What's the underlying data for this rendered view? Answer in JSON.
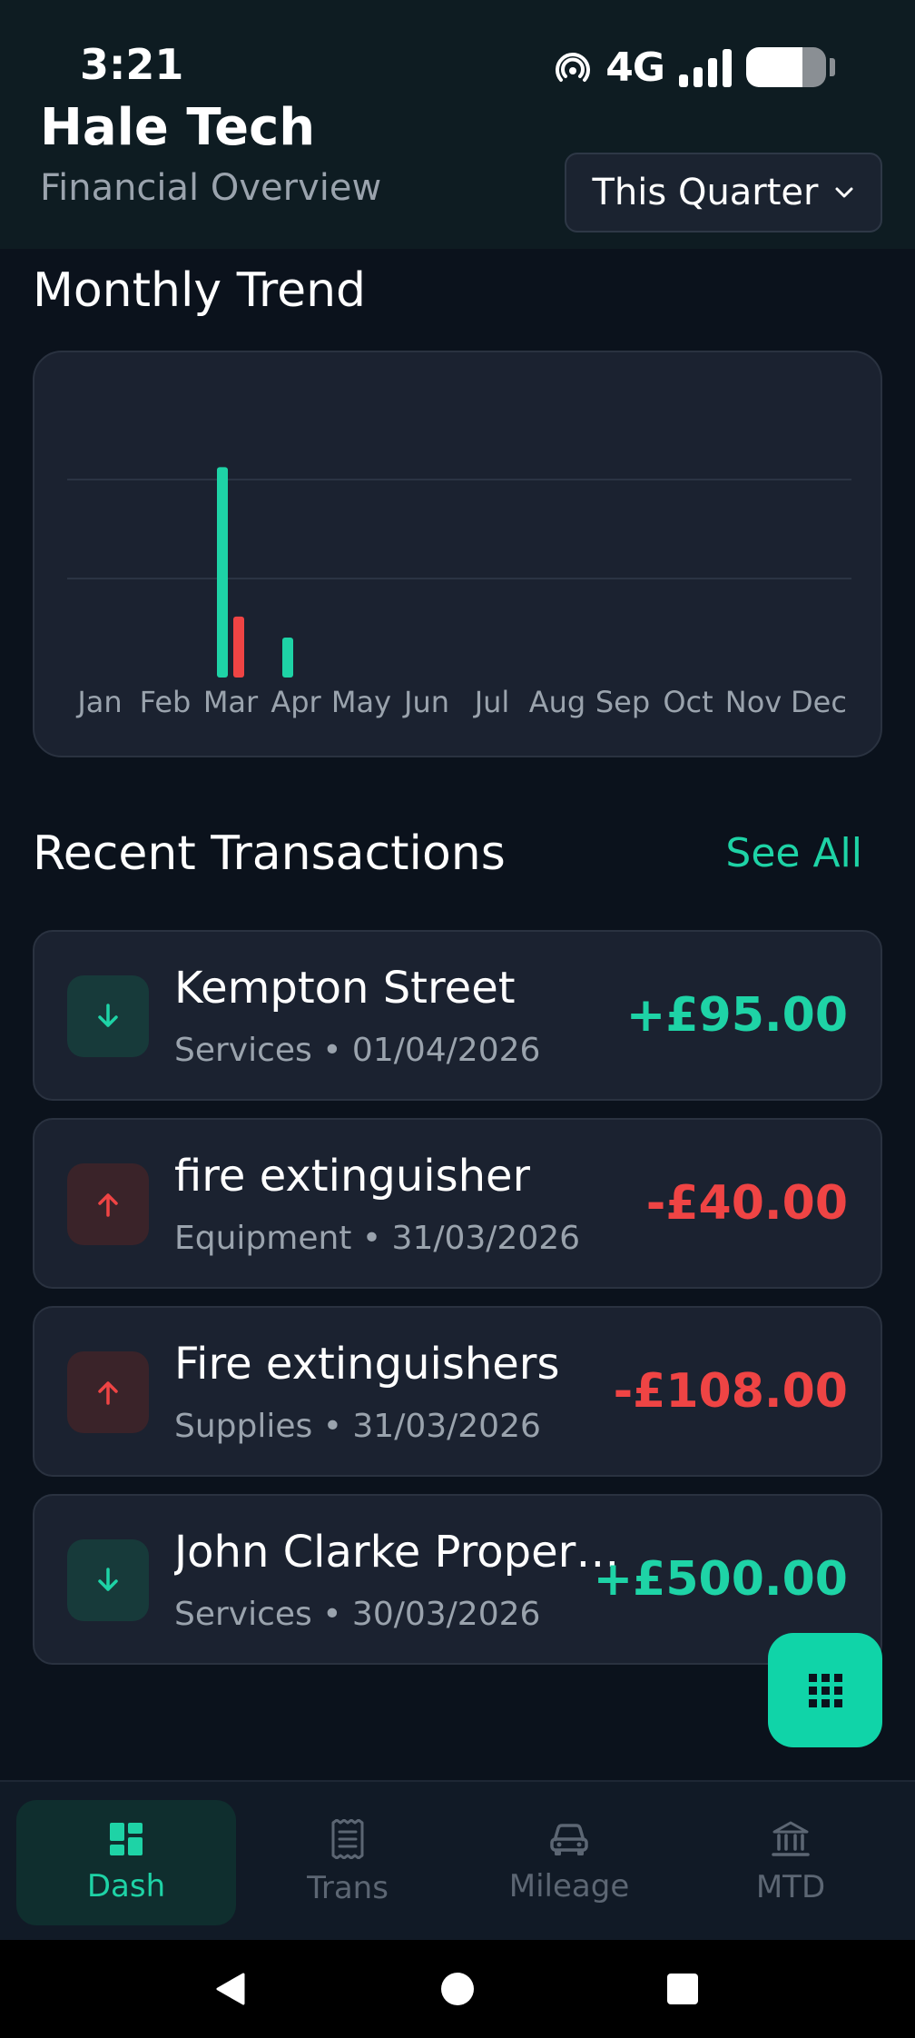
{
  "status_bar": {
    "time": "3:21",
    "network": "4G",
    "battery_level": 0.7
  },
  "header": {
    "title": "Hale Tech",
    "subtitle": "Financial Overview",
    "period_select": "This Quarter"
  },
  "chart_section": {
    "title": "Monthly Trend"
  },
  "chart_data": {
    "type": "bar",
    "categories": [
      "Jan",
      "Feb",
      "Mar",
      "Apr",
      "May",
      "Jun",
      "Jul",
      "Aug",
      "Sep",
      "Oct",
      "Nov",
      "Dec"
    ],
    "series": [
      {
        "color": "#1ed3a6",
        "values": [
          0,
          0,
          1000,
          190,
          0,
          0,
          0,
          0,
          0,
          0,
          0,
          0
        ]
      },
      {
        "color": "#ef4444",
        "values": [
          0,
          0,
          290,
          0,
          0,
          0,
          0,
          0,
          0,
          0,
          0,
          0
        ]
      }
    ],
    "ylim": [
      0,
      1200
    ],
    "grid": true
  },
  "transactions_section": {
    "title": "Recent Transactions",
    "see_all": "See All",
    "items": [
      {
        "name": "Kempton Street",
        "meta": "Services • 01/04/2026",
        "amount": "+£95.00",
        "direction": "in"
      },
      {
        "name": "fire extinguisher",
        "meta": "Equipment • 31/03/2026",
        "amount": "-£40.00",
        "direction": "out"
      },
      {
        "name": "Fire extinguishers",
        "meta": "Supplies • 31/03/2026",
        "amount": "-£108.00",
        "direction": "out"
      },
      {
        "name": "John Clarke Proper…",
        "meta": "Services • 30/03/2026",
        "amount": "+£500.00",
        "direction": "in"
      }
    ]
  },
  "bottom_nav": {
    "items": [
      {
        "label": "Dash",
        "icon": "dashboard-icon",
        "active": true
      },
      {
        "label": "Trans",
        "icon": "receipt-icon",
        "active": false
      },
      {
        "label": "Mileage",
        "icon": "car-icon",
        "active": false
      },
      {
        "label": "MTD",
        "icon": "bank-icon",
        "active": false
      }
    ]
  },
  "colors": {
    "accent": "#1ed3a6",
    "expense": "#ef4444",
    "background": "#0b121c",
    "card": "#1b2230"
  }
}
